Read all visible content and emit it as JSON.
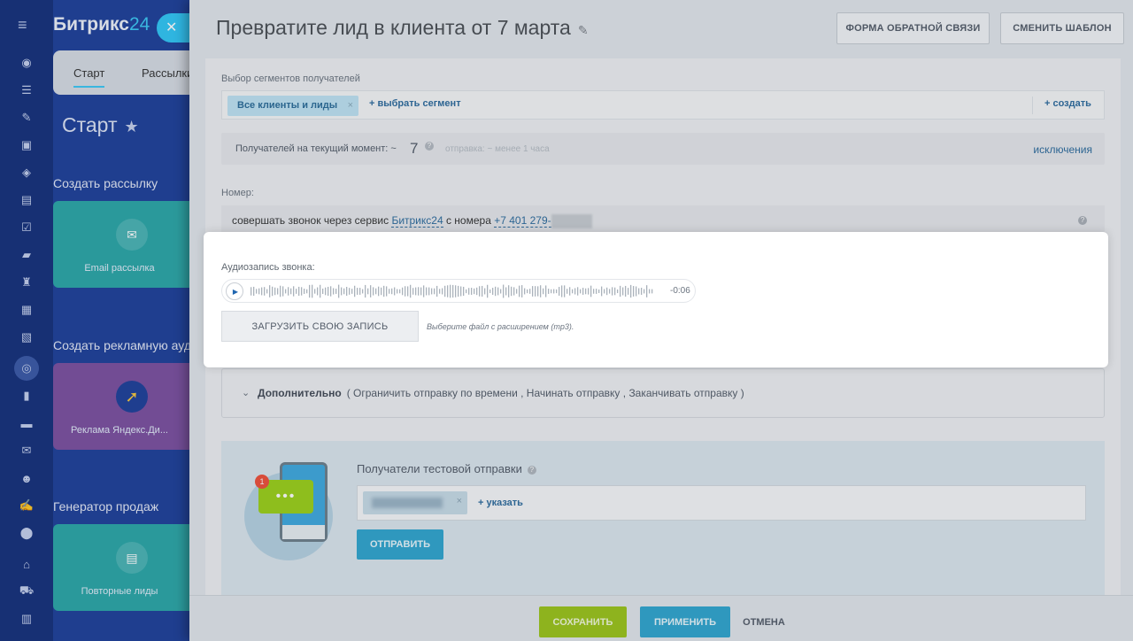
{
  "app": {
    "logo_name": "Битрикс",
    "logo_number": "24"
  },
  "background_page": {
    "tabs": [
      "Старт",
      "Рассылки"
    ],
    "page_title": "Старт",
    "sections": [
      {
        "heading": "Создать рассылку",
        "card_label": "Email рассылка",
        "card_color": "#2aa7a8"
      },
      {
        "heading": "Создать рекламную аудиторию",
        "card_label": "Реклама Яндекс.Ди...",
        "card_color": "#7b4fa0"
      },
      {
        "heading": "Генератор продаж",
        "card_label": "Повторные лиды",
        "card_color": "#2aa7a8"
      }
    ]
  },
  "slider": {
    "title": "Превратите лид в клиента от 7 марта",
    "header_buttons": [
      "ФОРМА ОБРАТНОЙ СВЯЗИ",
      "СМЕНИТЬ ШАБЛОН"
    ],
    "segments": {
      "label": "Выбор сегментов получателей",
      "chip": "Все клиенты и лиды",
      "select_link": "выбрать сегмент",
      "create_link": "создать"
    },
    "recipients": {
      "label": "Получателей на текущий момент: ~",
      "count": "7",
      "send_time": "отправка: ~ менее 1 часа",
      "exclusions_link": "исключения"
    },
    "number": {
      "label": "Номер:",
      "text_prefix": "совершать звонок через сервис",
      "service_link": "Битрикс24",
      "text_middle": "с номера",
      "phone": "+7 401 279-"
    },
    "audio": {
      "label": "Аудиозапись звонка:",
      "time": "-0:06",
      "upload_button": "ЗАГРУЗИТЬ СВОЮ ЗАПИСЬ",
      "upload_hint": "Выберите файл с расширением (mp3)."
    },
    "additional": {
      "title": "Дополнительно",
      "options": "( Ограничить отправку по времени ,  Начинать отправку ,  Заканчивать отправку )"
    },
    "test": {
      "title": "Получатели тестовой отправки",
      "add_link": "указать",
      "send_button": "ОТПРАВИТЬ",
      "badge": "1"
    },
    "footer": {
      "save": "СОХРАНИТЬ",
      "apply": "ПРИМЕНИТЬ",
      "cancel": "ОТМЕНА"
    }
  },
  "colors": {
    "save_button": "#9bc41a",
    "apply_button": "#2fa6d0",
    "link": "#2d6b9e"
  }
}
